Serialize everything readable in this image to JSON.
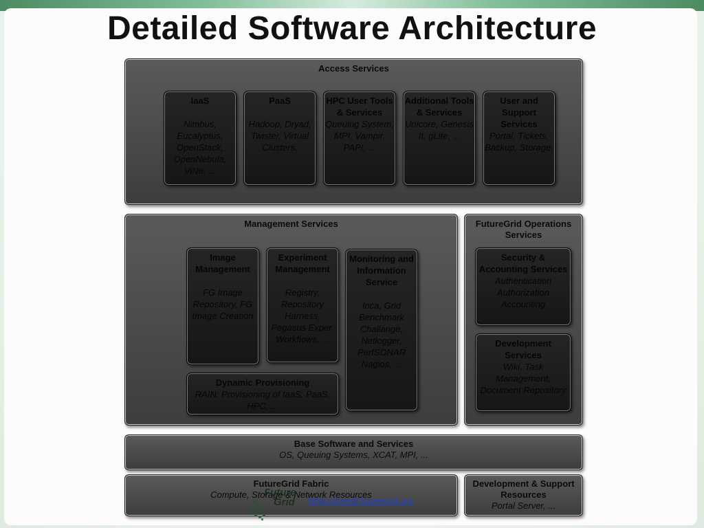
{
  "title": "Detailed Software Architecture",
  "access": {
    "title": "Access Services",
    "cards": [
      {
        "title": "IaaS",
        "body": "Nimbus, Eucalyptus, OpenStack, OpenNebula, ViNe, ..."
      },
      {
        "title": "PaaS",
        "body": "Hadoop, Dryad, Twister, Virtual Clusters,"
      },
      {
        "title": "HPC User Tools & Services",
        "body": "Queuing System, MPI, Vampir, PAPI, ..."
      },
      {
        "title": "Additional Tools & Services",
        "body": "Unicore, Genesis II, gLite, ..."
      },
      {
        "title": "User and Support Services",
        "body": "Portal, Tickets, Backup, Storage,"
      }
    ]
  },
  "management": {
    "title": "Management Services",
    "image": {
      "title": "Image Management",
      "body": "FG Image Repository, FG Image Creation"
    },
    "experiment": {
      "title": "Experiment Management",
      "body": "Registry, Repository Harness, Pegasus Exper. Workflows, ..."
    },
    "monitoring": {
      "title": "Monitoring and Information Service",
      "body": "Inca, Grid Benchmark Challange, Netlogger, PerfSONAR Nagios, ..."
    },
    "dynamic": {
      "title": "Dynamic Provisioning",
      "body": "RAIN: Provisioning of IaaS, PaaS, HPC, ..."
    }
  },
  "operations": {
    "title": "FutureGrid Operations Services",
    "security": {
      "title": "Security & Accounting Services",
      "body": "Authentication Authorization Accounting"
    },
    "development": {
      "title": "Development Services",
      "body": "Wiki, Task Management, Document Repository"
    }
  },
  "base": {
    "title": "Base Software and Services",
    "body": "OS, Queuing Systems, XCAT, MPI, ..."
  },
  "fabric": {
    "title": "FutureGrid Fabric",
    "body": "Compute, Storage & Network Resources"
  },
  "devsupport": {
    "title": "Development & Support Resources",
    "body": "Portal Server, ..."
  },
  "logo_text": {
    "line1": "Future",
    "line2": "Grid"
  },
  "url": "https://portal.futuregrid.org"
}
